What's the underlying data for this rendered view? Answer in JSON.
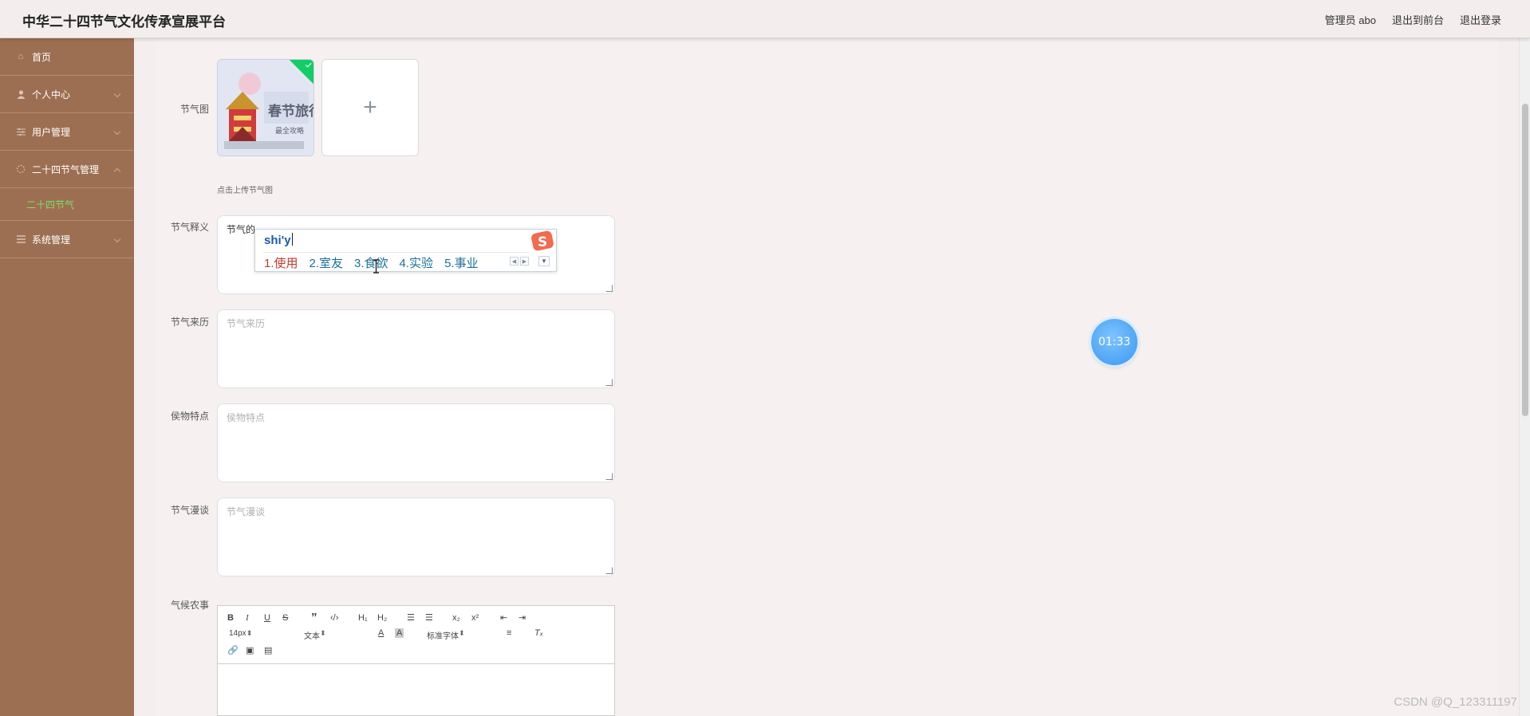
{
  "header": {
    "title": "中华二十四节气文化传承宣展平台",
    "admin": "管理员 abo",
    "to_front": "退出到前台",
    "logout": "退出登录"
  },
  "sidebar": {
    "items": [
      {
        "label": "首页",
        "icon": "home-icon"
      },
      {
        "label": "个人中心",
        "icon": "user-icon"
      },
      {
        "label": "用户管理",
        "icon": "users-icon"
      },
      {
        "label": "二十四节气管理",
        "icon": "sun-icon"
      },
      {
        "label": "二十四节气",
        "icon": ""
      },
      {
        "label": "系统管理",
        "icon": "menu-icon"
      }
    ],
    "active_color": "#7dde6a",
    "bg_color": "#9d6f52"
  },
  "form": {
    "image_label": "节气图",
    "image_thumb_text": "春节旅行",
    "image_thumb_sub": "最全攻略",
    "upload_hint": "点击上传节气图",
    "meaning_label": "节气释义",
    "meaning_value": "节气的",
    "origin_label": "节气来历",
    "origin_placeholder": "节气来历",
    "phenology_label": "侯物特点",
    "phenology_placeholder": "侯物特点",
    "talk_label": "节气漫谈",
    "talk_placeholder": "节气漫谈",
    "farming_label": "气候农事"
  },
  "ime": {
    "composition": "shi'y",
    "candidates": [
      "1.使用",
      "2.室友",
      "3.食欲",
      "4.实验",
      "5.事业"
    ]
  },
  "editor": {
    "font_size": "14px",
    "block_type": "文本",
    "font_family": "标准字体"
  },
  "timer": "01:33",
  "watermark": "CSDN @Q_123311197"
}
